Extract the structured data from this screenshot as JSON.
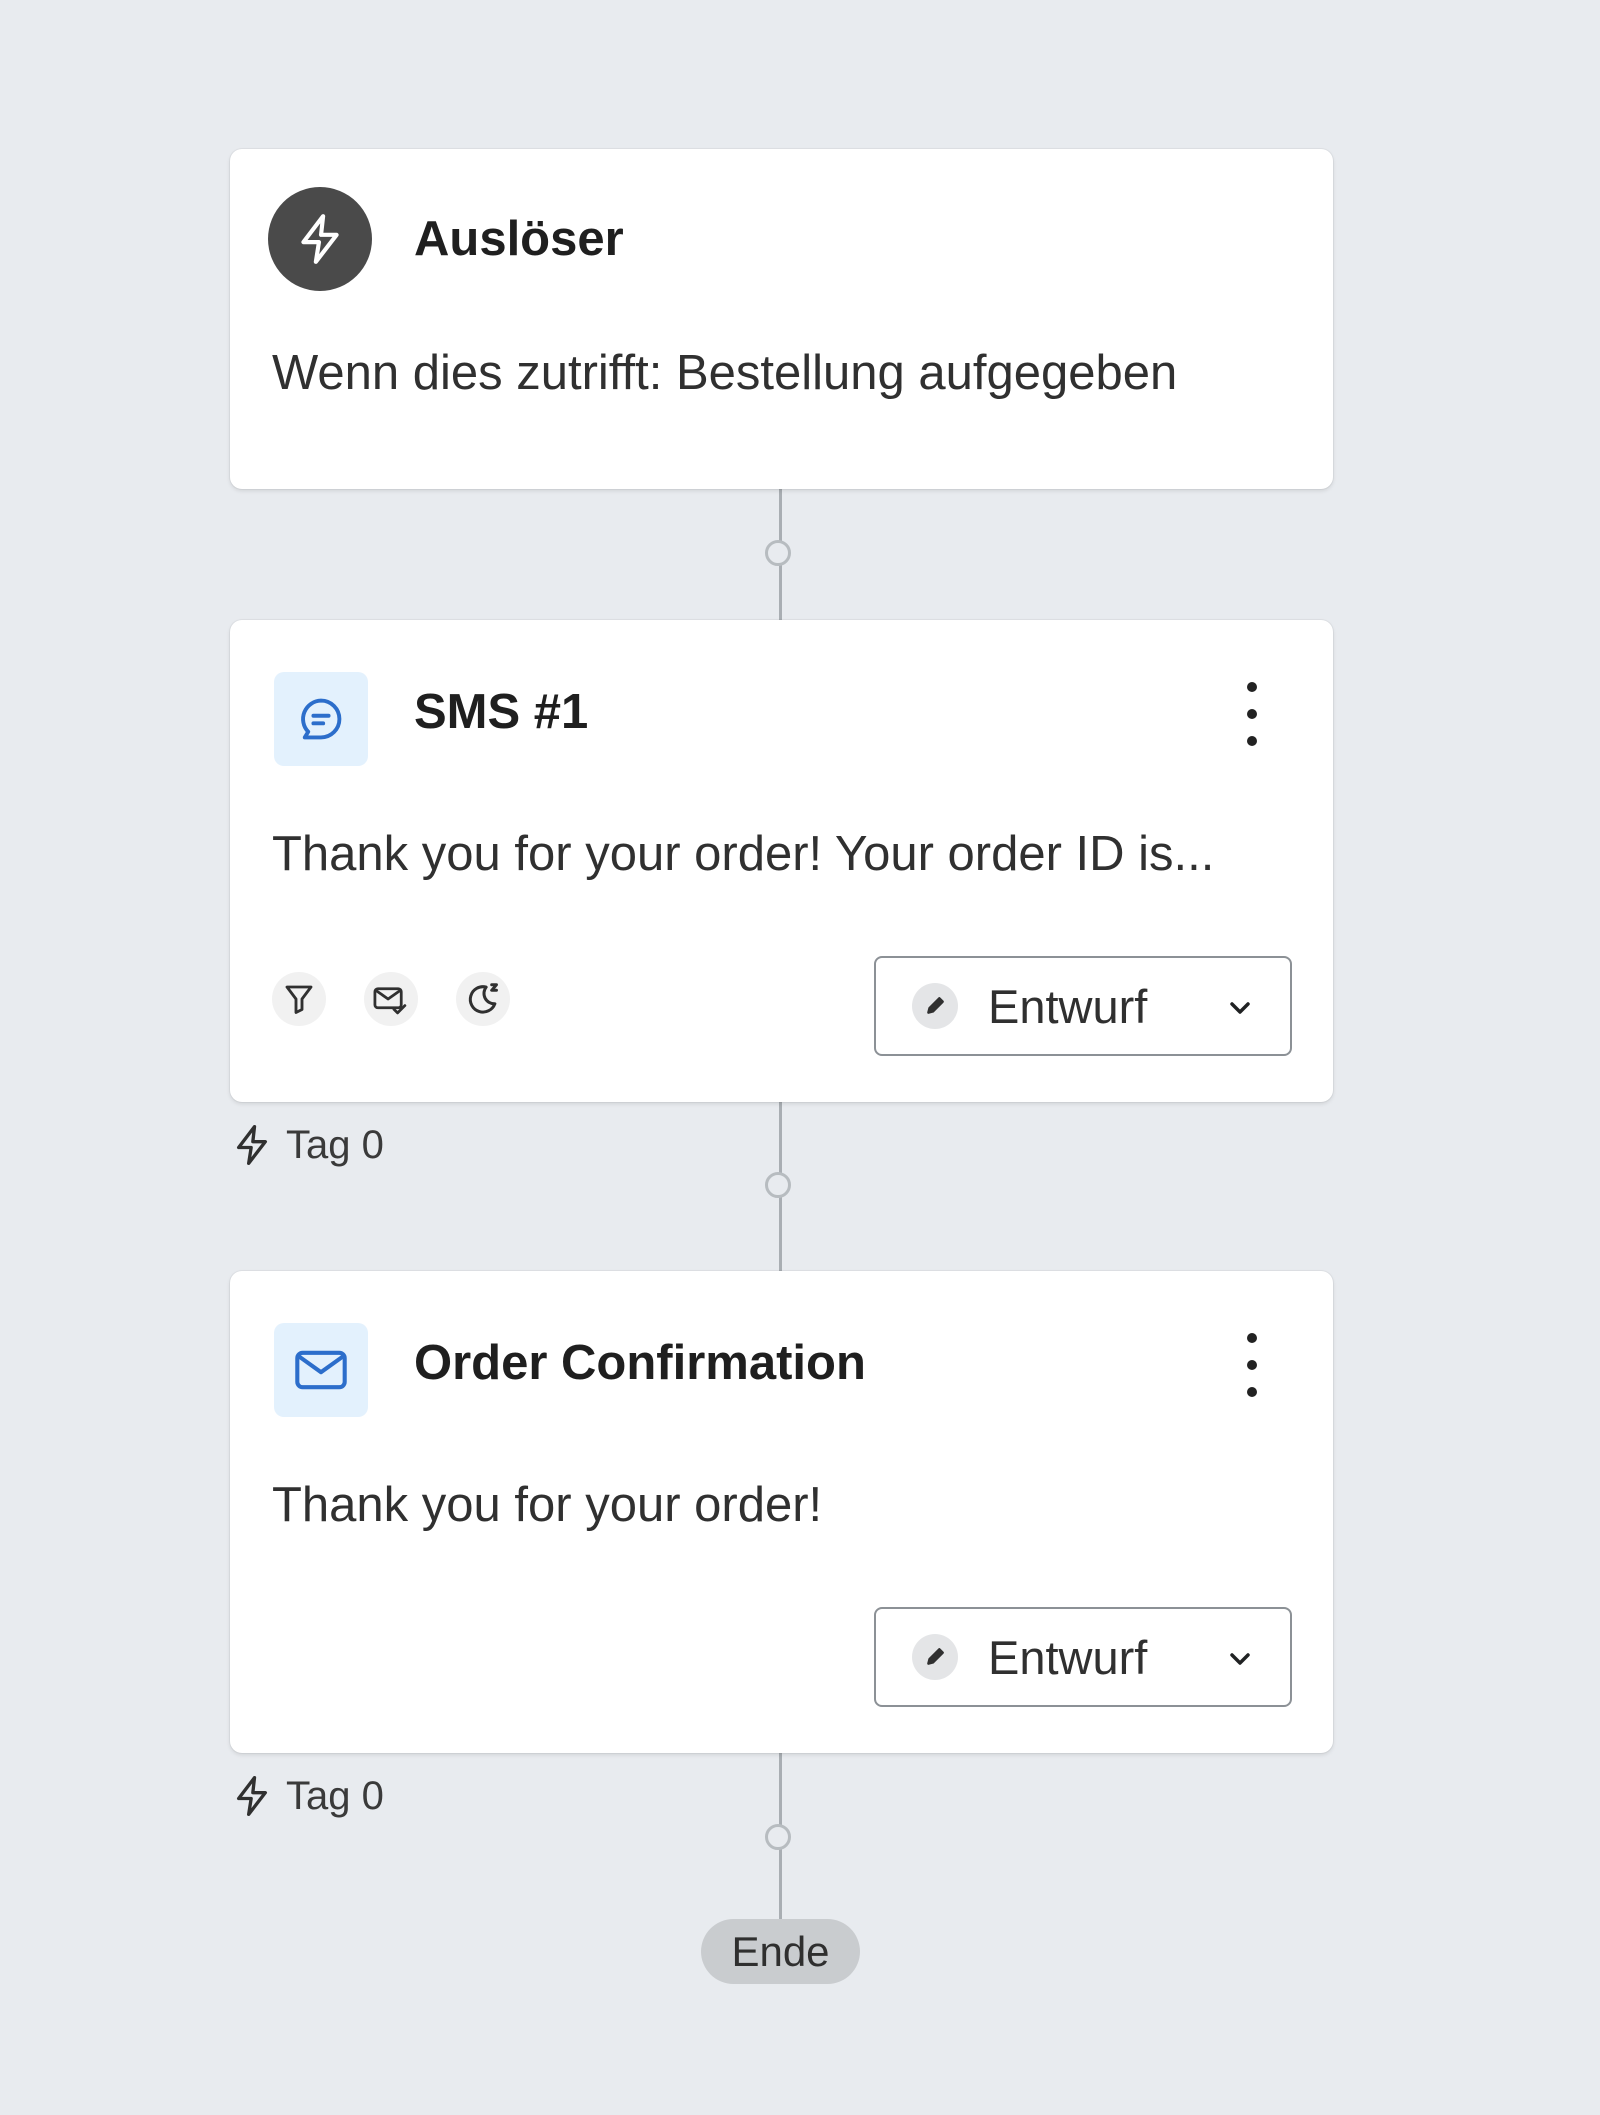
{
  "flow": {
    "trigger": {
      "title": "Auslöser",
      "description": "Wenn dies zutrifft: Bestellung aufgegeben",
      "icon": "lightning-icon"
    },
    "steps": [
      {
        "title": "SMS #1",
        "description": "Thank you for your order! Your order ID is...",
        "icon": "chat-bubble-icon",
        "status": "Entwurf",
        "tool_icons": [
          "filter-icon",
          "mail-check-icon",
          "moon-sleep-icon"
        ],
        "delay_label": "Tag 0"
      },
      {
        "title": "Order Confirmation",
        "description": "Thank you for your order!",
        "icon": "envelope-icon",
        "status": "Entwurf",
        "delay_label": "Tag 0"
      }
    ],
    "end_label": "Ende"
  },
  "colors": {
    "background": "#e8ebef",
    "card": "#ffffff",
    "trigger_icon_bg": "#4a4a4a",
    "message_icon_bg": "#e3f1fd",
    "message_icon_stroke": "#2c6ecb",
    "connector": "#a9aeb3",
    "end_pill": "#c9cccf"
  }
}
